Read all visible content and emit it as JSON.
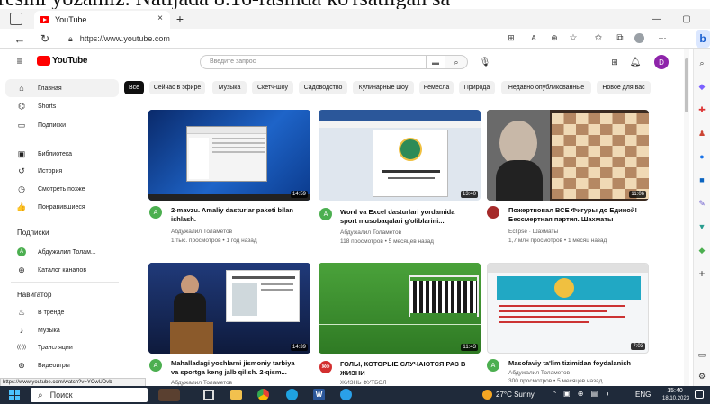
{
  "banner": {
    "text": "resini yozamiz. Natijada 8.16-rasmda ko'rsatilgan sa"
  },
  "browser": {
    "tab_title": "YouTube",
    "tab_close": "×",
    "new_tab": "+",
    "url": "https://www.youtube.com",
    "window_minimize": "—",
    "window_maximize": "▢",
    "more": "···"
  },
  "header": {
    "logo": "YouTube",
    "search_placeholder": "Введите запрос",
    "avatar_letter": "D"
  },
  "sidebar": {
    "items": [
      {
        "label": "Главная",
        "icon": "home-icon",
        "glyph": "⌂"
      },
      {
        "label": "Shorts",
        "icon": "shorts-icon",
        "glyph": "⌬"
      },
      {
        "label": "Подписки",
        "icon": "subscriptions-icon",
        "glyph": "▭"
      }
    ],
    "library": [
      {
        "label": "Библиотека",
        "icon": "library-icon",
        "glyph": "▣"
      },
      {
        "label": "История",
        "icon": "history-icon",
        "glyph": "↺"
      },
      {
        "label": "Смотреть позже",
        "icon": "watch-later-icon",
        "glyph": "◷"
      },
      {
        "label": "Понравившиеся",
        "icon": "like-icon",
        "glyph": "👍"
      }
    ],
    "subs_heading": "Подписки",
    "subs": [
      {
        "label": "Абдужалил Толам...",
        "icon": "channel-avatar-icon",
        "glyph": "A"
      },
      {
        "label": "Каталог каналов",
        "icon": "channel-catalog-icon",
        "glyph": "⊕"
      }
    ],
    "nav_heading": "Навигатор",
    "nav": [
      {
        "label": "В тренде",
        "icon": "trending-icon",
        "glyph": "♨"
      },
      {
        "label": "Музыка",
        "icon": "music-icon",
        "glyph": "♪"
      },
      {
        "label": "Трансляции",
        "icon": "live-icon",
        "glyph": "((·))"
      },
      {
        "label": "Видеоигры",
        "icon": "gaming-icon",
        "glyph": "⊛"
      }
    ]
  },
  "chips": [
    "Все",
    "Сейчас в эфире",
    "Музыка",
    "Скетч-шоу",
    "Садоводство",
    "Кулинарные шоу",
    "Ремесла",
    "Природа",
    "Недавно опубликованные",
    "Новое для вас"
  ],
  "videos": [
    {
      "title1": "2-mavzu. Amaliy dasturlar paketi bilan",
      "title2": "ishlash.",
      "channel": "Абдужалил Толаметов",
      "meta": "1 тыс. просмотров • 1 год назад",
      "duration": "14:59",
      "avatar": "A",
      "avatar_color": "#4caf50"
    },
    {
      "title1": "Word va Excel dasturlari yordamida",
      "title2": "sport musobaqalari g'oliblarini...",
      "channel": "Абдужалил Толаметов",
      "meta": "118 просмотров • 5 месяцев назад",
      "duration": "13:40",
      "avatar": "A",
      "avatar_color": "#4caf50"
    },
    {
      "title1": "Пожертвовал ВСЕ Фигуры до Единой!",
      "title2": "Бессмертная партия. Шахматы",
      "channel": "Eclipse · Шахматы",
      "meta": "1,7 млн просмотров • 1 месяц назад",
      "duration": "11:06",
      "avatar": "",
      "avatar_color": "#a52a2a"
    },
    {
      "title1": "Mahalladagi yoshlarni jismoniy tarbiya",
      "title2": "va sportga keng jalb qilish. 2-qism...",
      "channel": "Абдужалил Толаметов",
      "meta": "",
      "duration": "14:39",
      "avatar": "A",
      "avatar_color": "#4caf50"
    },
    {
      "title1": "ГОЛЫ, КОТОРЫЕ СЛУЧАЮТСЯ РАЗ В",
      "title2": "ЖИЗНИ",
      "channel": "ЖИЗНЬ ФУТБОЛ",
      "meta": "",
      "duration": "11:43",
      "avatar": "ЖФ",
      "avatar_color": "#d32f2f"
    },
    {
      "title1": "Masofaviy ta'lim tizimidan foydalanish",
      "title2": "",
      "channel": "Абдужалил Толаметов",
      "meta": "300 просмотров • 5 месяцев назад",
      "duration": "7:03",
      "avatar": "A",
      "avatar_color": "#4caf50"
    }
  ],
  "status_url": "https://www.youtube.com/watch?v=YCwUDvb",
  "taskbar": {
    "search": "Поиск",
    "weather": "27°C Sunny",
    "lang": "ENG",
    "time": "15:40",
    "date": "18.10.2023"
  }
}
